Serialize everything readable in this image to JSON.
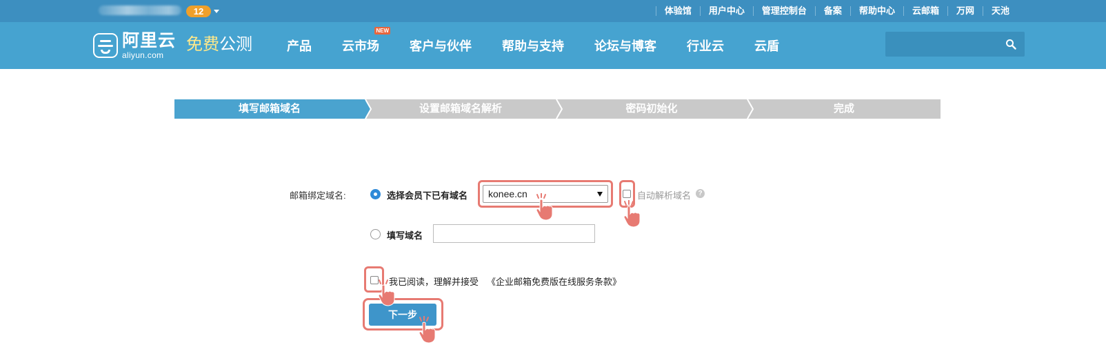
{
  "topbar": {
    "badge": "12",
    "links": [
      "体验馆",
      "用户中心",
      "管理控制台",
      "备案",
      "帮助中心",
      "云邮箱",
      "万网",
      "天池"
    ]
  },
  "nav": {
    "logo_cn": "阿里云",
    "logo_en": "aliyun.com",
    "promo_yellow": "免费",
    "promo_white": "公测",
    "items": [
      "产品",
      "云市场",
      "客户与伙伴",
      "帮助与支持",
      "论坛与博客",
      "行业云",
      "云盾"
    ],
    "new_tag": "NEW"
  },
  "steps": [
    "填写邮箱域名",
    "设置邮箱域名解析",
    "密码初始化",
    "完成"
  ],
  "form": {
    "bind_label": "邮箱绑定域名:",
    "option_existing": "选择会员下已有域名",
    "selected_domain": "konee.cn",
    "auto_resolve": "自动解析域名",
    "help_glyph": "?",
    "option_fill": "填写域名",
    "agree_text": "我已阅读，理解并接受",
    "terms_link": "《企业邮箱免费版在线服务条款》",
    "next_label": "下一步"
  },
  "colors": {
    "topbar": "#3d8fc0",
    "navbar": "#46a3d0",
    "step_active": "#4aa3cf",
    "step_inactive": "#c9c9c9",
    "highlight": "#e77a72",
    "button": "#3e95ca"
  },
  "icons": [
    "search-icon",
    "chevron-down-icon",
    "help-icon",
    "pointer-hand-icon",
    "aliyun-logo-icon"
  ]
}
